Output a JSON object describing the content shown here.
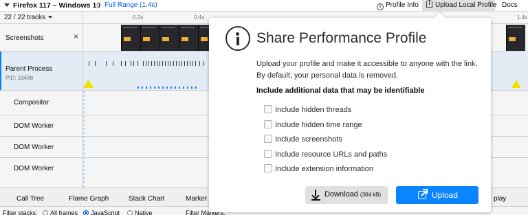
{
  "topbar": {
    "title": "Firefox 117 – Windows 10",
    "range": "Full Range (1.4s)",
    "profile_info": "Profile Info",
    "upload_local_profile": "Upload Local Profile",
    "docs": "Docs"
  },
  "timeline": {
    "tracks_count": "22 / 22 tracks",
    "ticks": [
      "0.2s",
      "0.4s",
      "1.4s"
    ],
    "tracks": [
      {
        "label": "Screenshots",
        "close": "×"
      },
      {
        "label": "Parent Process",
        "pid": "PID: 19488"
      },
      {
        "label": "Compositor"
      },
      {
        "label": "DOM Worker"
      },
      {
        "label": "DOM Worker"
      },
      {
        "label": "DOM Worker"
      }
    ]
  },
  "bottom": {
    "tabs": [
      "Call Tree",
      "Flame Graph",
      "Stack Chart",
      "Marker C",
      "play"
    ],
    "filter_stacks": "Filter stacks:",
    "all_frames": "All frames",
    "javascript": "JavaScript",
    "native": "Native",
    "filter_markers": "Filter Markers:"
  },
  "modal": {
    "title": "Share Performance Profile",
    "description": "Upload your profile and make it accessible to anyone with the link. By default, your personal data is removed.",
    "section": "Include additional data that may be identifiable",
    "options": [
      "Include hidden threads",
      "Include hidden time range",
      "Include screenshots",
      "Include resource URLs and paths",
      "Include extension information"
    ],
    "download_label": "Download",
    "download_size": "(304 kB)",
    "upload_label": "Upload"
  },
  "icons": {
    "info": "info-circle-icon",
    "upload": "upload-icon",
    "download": "download-icon",
    "share": "share-icon"
  },
  "colors": {
    "accent": "#0a84ff",
    "cpu_graph": "#ffe900",
    "selected_row": "#edf6ff"
  }
}
